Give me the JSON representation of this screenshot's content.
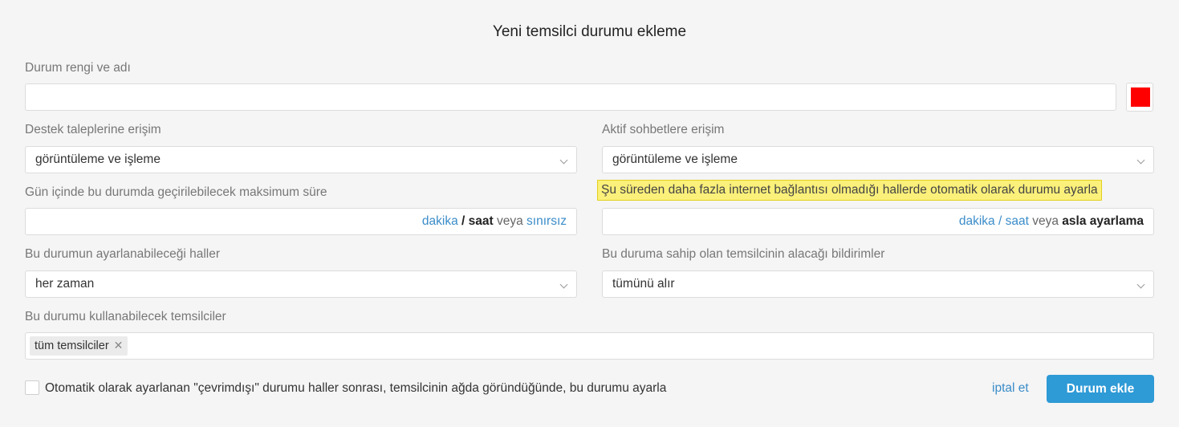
{
  "title": "Yeni temsilci durumu ekleme",
  "name_field": {
    "label": "Durum rengi ve adı",
    "value": "",
    "color": "#ff0000"
  },
  "ticket_access": {
    "label": "Destek taleplerine erişim",
    "value": "görüntüleme ve işleme"
  },
  "chat_access": {
    "label": "Aktif sohbetlere erişim",
    "value": "görüntüleme ve işleme"
  },
  "max_time": {
    "label": "Gün içinde bu durumda geçirilebilecek maksimum süre",
    "value": "",
    "unit_minutes": "dakika",
    "separator": "/",
    "unit_hours": "saat",
    "or": "veya",
    "unlimited": "sınırsız"
  },
  "auto_status": {
    "label": "Şu süreden daha fazla internet bağlantısı olmadığı hallerde otomatik olarak durumu ayarla",
    "value": "",
    "unit_minutes": "dakika",
    "separator": "/",
    "unit_hours": "saat",
    "or": "veya",
    "never": "asla ayarlama"
  },
  "set_cases": {
    "label": "Bu durumun ayarlanabileceği haller",
    "value": "her zaman"
  },
  "notifications": {
    "label": "Bu duruma sahip olan temsilcinin alacağı bildirimler",
    "value": "tümünü alır"
  },
  "agents": {
    "label": "Bu durumu kullanabilecek temsilciler",
    "tags": [
      "tüm temsilciler"
    ],
    "remove_glyph": "✕"
  },
  "offline_checkbox": {
    "checked": false,
    "label": "Otomatik olarak ayarlanan \"çevrimdışı\" durumu haller sonrası, temsilcinin ağda göründüğünde, bu durumu ayarla"
  },
  "actions": {
    "cancel": "iptal et",
    "submit": "Durum ekle"
  },
  "colors": {
    "accent": "#2e9ad6",
    "link": "#3a8cc9",
    "highlight": "#fbf07a"
  }
}
